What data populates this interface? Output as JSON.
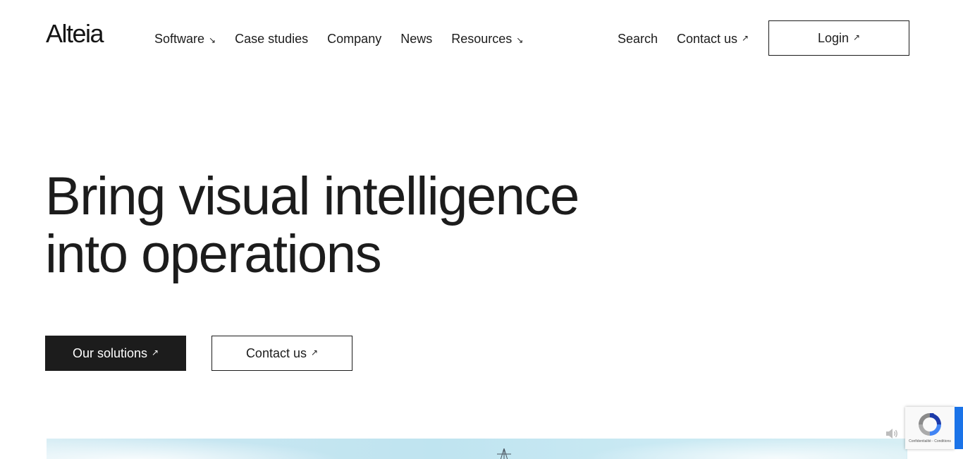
{
  "header": {
    "logo": "Alteia",
    "nav": [
      {
        "label": "Software",
        "arrow": "↘"
      },
      {
        "label": "Case studies",
        "arrow": ""
      },
      {
        "label": "Company",
        "arrow": ""
      },
      {
        "label": "News",
        "arrow": ""
      },
      {
        "label": "Resources",
        "arrow": "↘"
      }
    ],
    "search_label": "Search",
    "contact_label": "Contact us",
    "contact_arrow": "↗",
    "login_label": "Login",
    "login_arrow": "↗"
  },
  "hero": {
    "title_line1": "Bring visual intelligence",
    "title_line2": "into operations",
    "primary_button": "Our solutions",
    "primary_arrow": "↗",
    "secondary_button": "Contact us",
    "secondary_arrow": "↗"
  },
  "recaptcha": {
    "footer_text": "Confidentialité - Conditions"
  },
  "icons": {
    "sound": "speaker-icon",
    "recaptcha": "recaptcha-icon"
  },
  "colors": {
    "text": "#1c1c1c",
    "primary_bg": "#1c1c1c",
    "primary_text": "#ffffff",
    "recaptcha_blue": "#1a73e8"
  }
}
